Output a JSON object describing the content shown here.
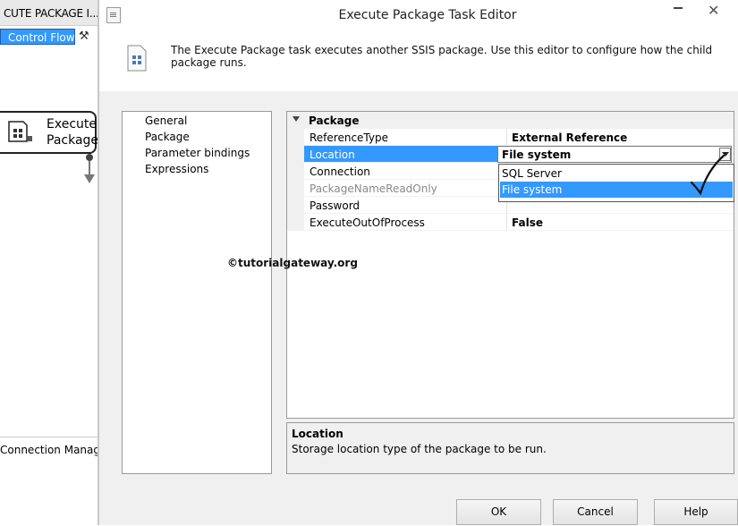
{
  "background": {
    "tab_title": "CUTE PACKAGE I...TI",
    "control_flow_label": "Control Flow",
    "task_label_line1": "Execute",
    "task_label_line2": "Package",
    "connection_managers_label": "Connection Manage"
  },
  "dialog": {
    "title": "Execute Package Task Editor",
    "intro_text": "The Execute Package task executes another SSIS package. Use this editor to configure how the child package runs.",
    "nav_items": [
      "General",
      "Package",
      "Parameter bindings",
      "Expressions"
    ],
    "selected_nav": "Package",
    "property_grid": {
      "category": "Package",
      "rows": [
        {
          "name": "ReferenceType",
          "value": "External Reference"
        },
        {
          "name": "Location",
          "value": "File system"
        },
        {
          "name": "Connection",
          "value": ""
        },
        {
          "name": "PackageNameReadOnly",
          "value": ""
        },
        {
          "name": "Password",
          "value": ""
        },
        {
          "name": "ExecuteOutOfProcess",
          "value": "False"
        }
      ],
      "selected_row": "Location",
      "dropdown_options": [
        "SQL Server",
        "File system"
      ],
      "dropdown_selected": "File system"
    },
    "description": {
      "title": "Location",
      "text": "Storage location type of the package to be run."
    },
    "watermark": "©tutorialgateway.org",
    "buttons": {
      "ok": "OK",
      "cancel": "Cancel",
      "help": "Help"
    }
  },
  "colors": {
    "selection": "#3399ff",
    "dialog_bg": "#f0f0f0"
  }
}
